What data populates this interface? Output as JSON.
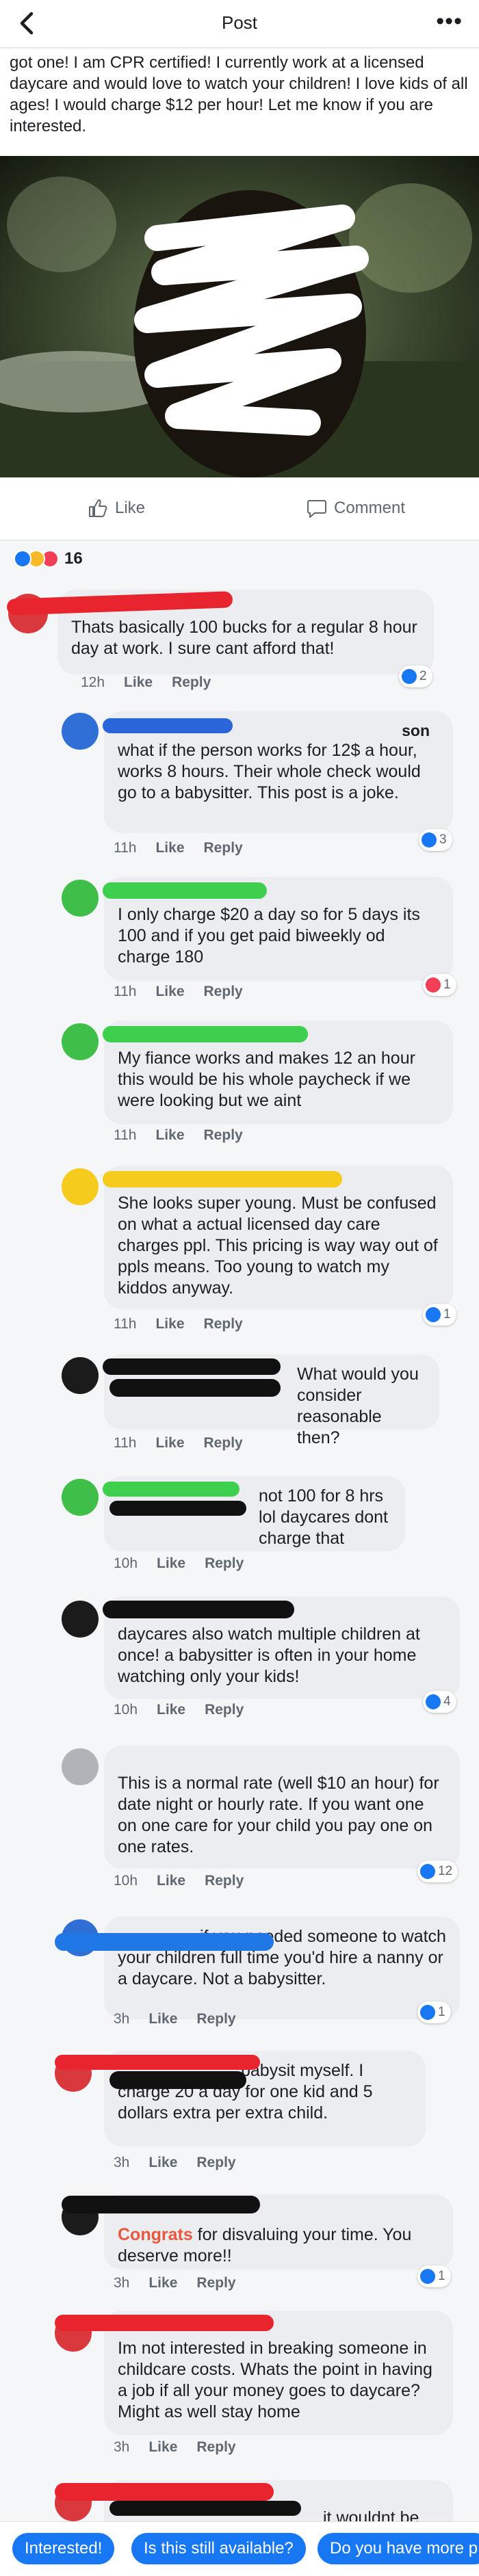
{
  "header": {
    "title": "Post"
  },
  "post": {
    "text": "got one! I am CPR certified! I currently work at a licensed daycare and would love to watch your children! I love kids of all ages! I would charge $12 per hour! Let me know if you are interested.",
    "actions": {
      "like": "Like",
      "comment": "Comment"
    },
    "reaction_count": "16"
  },
  "comments": [
    {
      "name": "",
      "text": "Thats basically 100 bucks for a regular 8 hour day at work. I sure cant afford that!",
      "time": "12h",
      "like": "Like",
      "reply": "Reply",
      "reactions": "2"
    },
    {
      "name": "son",
      "text": "what if the person works for 12$ a hour, works 8 hours. Their whole check would go to a babysitter. This post is a joke.",
      "time": "11h",
      "like": "Like",
      "reply": "Reply",
      "reactions": "3"
    },
    {
      "name": "",
      "text": "I only charge $20 a day so for 5 days its 100 and if you get paid biweekly od charge 180",
      "time": "11h",
      "like": "Like",
      "reply": "Reply",
      "reactions": "1"
    },
    {
      "name": "",
      "text": "My fiance works and makes 12 an hour this would be his whole paycheck if we were looking but we aint",
      "time": "11h",
      "like": "Like",
      "reply": "Reply"
    },
    {
      "name": "",
      "text": "She looks super young. Must be confused on what a actual licensed day care charges ppl. This pricing is way way out of ppls means. Too young to watch my kiddos anyway.",
      "time": "11h",
      "like": "Like",
      "reply": "Reply",
      "reactions": "1"
    },
    {
      "name": "",
      "text": "What would you consider reasonable then?",
      "time": "11h",
      "like": "Like",
      "reply": "Reply"
    },
    {
      "name": "",
      "text": "not 100 for 8 hrs lol daycares dont charge that",
      "time": "10h",
      "like": "Like",
      "reply": "Reply"
    },
    {
      "name": "",
      "text": "daycares also watch multiple children at once! a babysitter is often in your home watching only your kids!",
      "time": "10h",
      "like": "Like",
      "reply": "Reply",
      "reactions": "4"
    },
    {
      "name": "",
      "text": "This is a normal rate (well $10 an hour) for date night or hourly rate. If you want one on one care for your child you pay one on one rates.",
      "time": "10h",
      "like": "Like",
      "reply": "Reply",
      "reactions": "12"
    },
    {
      "name": "",
      "text": "if you needed someone to watch your children full time you'd hire a nanny or a daycare. Not a babysitter.",
      "time": "3h",
      "like": "Like",
      "reply": "Reply",
      "reactions": "1"
    },
    {
      "name": "",
      "text": "babysit myself. I charge 20 a day for one kid and 5 dollars extra per extra child.",
      "time": "3h",
      "like": "Like",
      "reply": "Reply"
    },
    {
      "name": "",
      "highlight": "Congrats",
      "text": " for disvaluing your time. You deserve more!!",
      "time": "3h",
      "like": "Like",
      "reply": "Reply",
      "reactions": "1"
    },
    {
      "name": "",
      "text": "Im not interested in breaking someone in childcare costs. Whats the point in having a job if all your money goes to daycare? Might as well stay home",
      "time": "3h",
      "like": "Like",
      "reply": "Reply"
    },
    {
      "name": "",
      "text": "it wouldnt be"
    }
  ],
  "quick_replies": [
    "Interested!",
    "Is this still available?",
    "Do you have more p"
  ],
  "colors": {
    "accent": "#1877f2",
    "bubble": "#ebedf0",
    "love": "#f33e58"
  }
}
